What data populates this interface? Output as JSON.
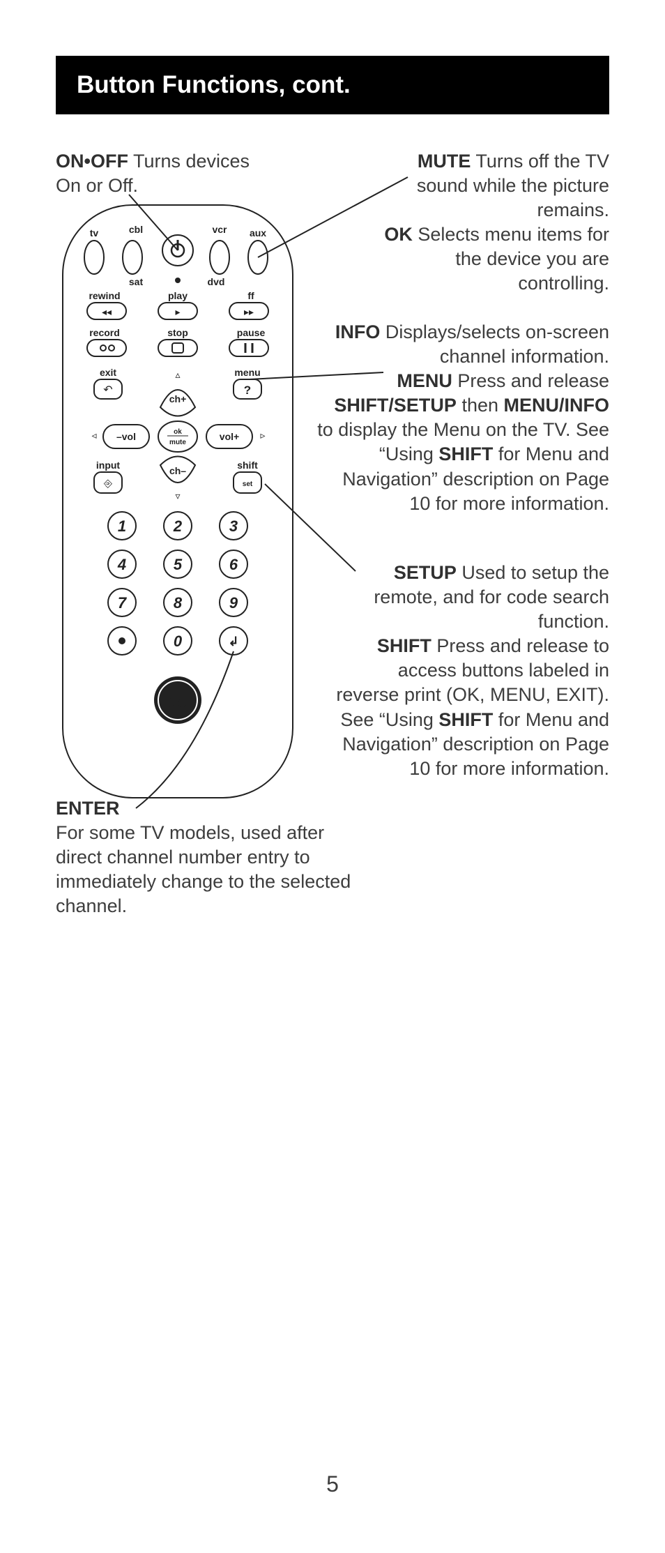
{
  "header": "Button Functions, cont.",
  "pageNumber": "5",
  "callouts": {
    "onoff": {
      "bold": "ON•OFF",
      "text": " Turns devices On or Off."
    },
    "muteok": {
      "parts": [
        {
          "b": "MUTE",
          "t": " Turns off the TV sound while the picture remains."
        },
        {
          "b": "OK",
          "t": " Selects menu items for the device you are controlling."
        }
      ]
    },
    "infomenu": {
      "parts": [
        {
          "b": "INFO",
          "t": " Displays/selects on-screen channel information."
        },
        {
          "b": "MENU",
          "t": " Press and release "
        },
        {
          "b": "SHIFT/SETUP",
          "t": " then "
        },
        {
          "b": "MENU/INFO",
          "t": " to display the Menu on the TV. See “Using "
        },
        {
          "b": "SHIFT",
          "t": " for Menu and Navigation” description on Page 10 for more information."
        }
      ]
    },
    "setupshift": {
      "parts": [
        {
          "b": "SETUP",
          "t": " Used to setup the remote, and for code search function."
        },
        {
          "b": "SHIFT",
          "t": " Press and release to access buttons labeled in reverse print (OK, MENU, EXIT). See “Using "
        },
        {
          "b": "SHIFT",
          "t": " for Menu and Navigation” description on Page 10 for more information."
        }
      ]
    },
    "enter": {
      "bold": "ENTER",
      "text": "For some TV models, used after direct channel number entry to immediately change to the selected channel."
    }
  },
  "remote": {
    "deviceLabels": {
      "tv": "tv",
      "cbl": "cbl",
      "sat": "sat",
      "vcr": "vcr",
      "dvd": "dvd",
      "aux": "aux"
    },
    "transportLabels": {
      "rewind": "rewind",
      "play": "play",
      "ff": "ff",
      "record": "record",
      "stop": "stop",
      "pause": "pause"
    },
    "navLabels": {
      "exit": "exit",
      "menu": "menu",
      "input": "input",
      "shift": "shift",
      "set": "set",
      "chplus": "ch+",
      "chminus": "ch–",
      "okmute_top": "ok",
      "okmute_bot": "mute",
      "volminus": "–vol",
      "volplus": "vol+"
    },
    "numbers": [
      "1",
      "2",
      "3",
      "4",
      "5",
      "6",
      "7",
      "8",
      "9",
      "0"
    ]
  }
}
